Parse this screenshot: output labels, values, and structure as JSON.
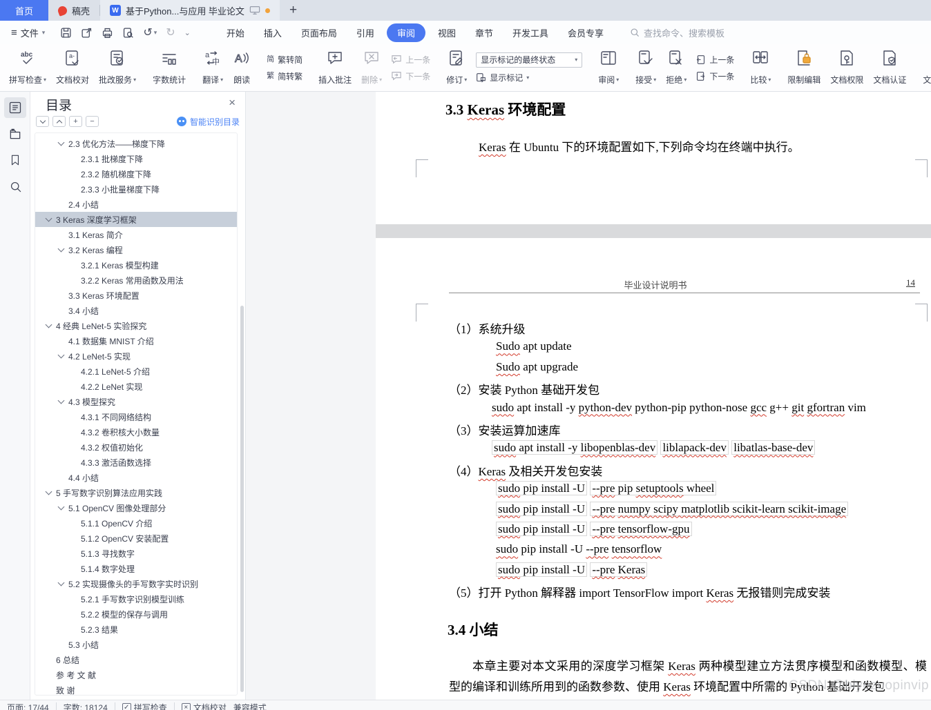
{
  "colors": {
    "accent": "#4b78f1",
    "tab_active_blue": "#4b78f1",
    "gaoke_red": "#e84335",
    "modified_dot": "#f2a33c",
    "squiggle_red": "#d23a2a",
    "toc_selected_bg": "#c7cfda",
    "lock_orange": "#f0a93c"
  },
  "tabs": {
    "home": "首页",
    "gaoke": "稿壳",
    "doc_title": "基于Python...与应用 毕业论文",
    "plus": "+"
  },
  "menu": {
    "file_label": "文件",
    "items": [
      "开始",
      "插入",
      "页面布局",
      "引用",
      "审阅",
      "视图",
      "章节",
      "开发工具",
      "会员专享"
    ],
    "active_item": "审阅",
    "search_placeholder": "查找命令、搜索模板"
  },
  "ribbon": {
    "spellcheck": "拼写检查",
    "proofread": "文档校对",
    "grading": "批改服务",
    "wordcount": "字数统计",
    "translate": "翻译",
    "readaloud": "朗读",
    "fan2jian": "繁转简",
    "jian2fan": "简转繁",
    "insert_comment": "插入批注",
    "delete": "删除",
    "prev_comment": "上一条",
    "next_comment": "下一条",
    "revise": "修订",
    "markstate_combo": "显示标记的最终状态",
    "showmark": "显示标记",
    "reviewpane": "审阅",
    "accept": "接受",
    "reject": "拒绝",
    "prev_rev": "上一条",
    "next_rev": "下一条",
    "compare": "比较",
    "restrict": "限制编辑",
    "perm": "文档权限",
    "cert": "文档认证",
    "final": "文档定稿"
  },
  "toc": {
    "title": "目录",
    "smart_label": "智能识别目录",
    "tools": [
      "collapse-all",
      "expand-all",
      "expand",
      "collapse"
    ],
    "items": [
      {
        "lv": 2,
        "chev": 1,
        "t": "2.3 优化方法——梯度下降"
      },
      {
        "lv": 3,
        "t": "2.3.1 批梯度下降"
      },
      {
        "lv": 3,
        "t": "2.3.2 随机梯度下降"
      },
      {
        "lv": 3,
        "t": "2.3.3 小批量梯度下降"
      },
      {
        "lv": 2,
        "t": "2.4 小结"
      },
      {
        "lv": 1,
        "chev": 1,
        "sel": 1,
        "t": "3 Keras 深度学习框架"
      },
      {
        "lv": 2,
        "t": "3.1 Keras 简介"
      },
      {
        "lv": 2,
        "chev": 1,
        "t": "3.2 Keras 编程"
      },
      {
        "lv": 3,
        "t": "3.2.1 Keras 模型构建"
      },
      {
        "lv": 3,
        "t": "3.2.2 Keras 常用函数及用法"
      },
      {
        "lv": 2,
        "t": "3.3 Keras 环境配置"
      },
      {
        "lv": 2,
        "t": "3.4 小结"
      },
      {
        "lv": 1,
        "chev": 1,
        "t": "4 经典 LeNet-5 实验探究"
      },
      {
        "lv": 2,
        "t": "4.1 数据集 MNIST 介绍"
      },
      {
        "lv": 2,
        "chev": 1,
        "t": "4.2 LeNet-5 实现"
      },
      {
        "lv": 3,
        "t": "4.2.1 LeNet-5 介绍"
      },
      {
        "lv": 3,
        "t": "4.2.2 LeNet 实现"
      },
      {
        "lv": 2,
        "chev": 1,
        "t": "4.3 模型探究"
      },
      {
        "lv": 3,
        "t": "4.3.1 不同网络结构"
      },
      {
        "lv": 3,
        "t": "4.3.2 卷积核大小数量"
      },
      {
        "lv": 3,
        "t": "4.3.2 权值初始化"
      },
      {
        "lv": 3,
        "t": "4.3.3 激活函数选择"
      },
      {
        "lv": 2,
        "t": "4.4 小结"
      },
      {
        "lv": 1,
        "chev": 1,
        "t": "5 手写数字识别算法应用实践"
      },
      {
        "lv": 2,
        "chev": 1,
        "t": "5.1 OpenCV 图像处理部分"
      },
      {
        "lv": 3,
        "t": "5.1.1 OpenCV 介绍"
      },
      {
        "lv": 3,
        "t": "5.1.2 OpenCV 安装配置"
      },
      {
        "lv": 3,
        "t": "5.1.3 寻找数字"
      },
      {
        "lv": 3,
        "t": "5.1.4 数字处理"
      },
      {
        "lv": 2,
        "chev": 1,
        "t": "5.2 实现摄像头的手写数字实时识别"
      },
      {
        "lv": 3,
        "t": "5.2.1 手写数字识别模型训练"
      },
      {
        "lv": 3,
        "t": "5.2.2 模型的保存与调用"
      },
      {
        "lv": 3,
        "t": "5.2.3 结果"
      },
      {
        "lv": 2,
        "t": "5.3 小结"
      },
      {
        "lv": 1,
        "t": "6 总结"
      },
      {
        "lv": 1,
        "t": "参 考 文 献"
      },
      {
        "lv": 1,
        "t": "致 谢"
      }
    ]
  },
  "doc": {
    "page1": {
      "heading": [
        {
          "t": "3.3 "
        },
        {
          "t": "Keras",
          "sq": 1
        },
        {
          "t": " 环境配置"
        }
      ],
      "para": [
        {
          "t": "Keras",
          "sq": 1
        },
        {
          "t": " 在 Ubuntu 下的环境配置如下,下列命令均在终端中执行。"
        }
      ]
    },
    "page2": {
      "header_title": "毕业设计说明书",
      "page_number": "14",
      "lines": [
        {
          "indent": 0,
          "segs": [
            {
              "t": "（1）系统升级"
            }
          ]
        },
        {
          "indent": 2,
          "segs": [
            {
              "t": "Sudo",
              "sq": 1
            },
            {
              "t": " apt update"
            }
          ]
        },
        {
          "indent": 2,
          "segs": [
            {
              "t": "Sudo",
              "sq": 1
            },
            {
              "t": " apt upgrade"
            }
          ]
        },
        {
          "indent": 0,
          "segs": [
            {
              "t": "（2）安装 Python 基础开发包"
            }
          ]
        },
        {
          "indent": 1,
          "segs": [
            {
              "t": "sudo",
              "sq": 1
            },
            {
              "t": " apt install -y "
            },
            {
              "t": "python-dev",
              "sq": 1
            },
            {
              "t": " python-pip python-nose "
            },
            {
              "t": "gcc",
              "sq": 1
            },
            {
              "t": " g++ "
            },
            {
              "t": "git",
              "sq": 1
            },
            {
              "t": " "
            },
            {
              "t": "gfortran",
              "sq": 1
            },
            {
              "t": " vim"
            }
          ]
        },
        {
          "indent": 0,
          "segs": [
            {
              "t": "（3）安装运算加速库"
            }
          ]
        },
        {
          "indent": 1,
          "segs": [
            {
              "box": [
                {
                  "t": "sudo",
                  "sq": 1
                },
                {
                  "t": " apt install -y "
                },
                {
                  "t": "libopenblas-dev",
                  "sq": 1
                }
              ]
            },
            {
              "t": " "
            },
            {
              "box": [
                {
                  "t": "liblapack-dev",
                  "sq": 1
                }
              ]
            },
            {
              "t": " "
            },
            {
              "box": [
                {
                  "t": "libatlas-base-dev",
                  "sq": 1
                }
              ]
            }
          ]
        },
        {
          "indent": 0,
          "segs": [
            {
              "t": "（4）"
            },
            {
              "t": "Keras",
              "sq": 1
            },
            {
              "t": " 及相关开发包安装"
            }
          ]
        },
        {
          "indent": 2,
          "segs": [
            {
              "box": [
                {
                  "t": "sudo",
                  "sq": 1
                },
                {
                  "t": " pip install -U"
                }
              ]
            },
            {
              "t": " "
            },
            {
              "box": [
                {
                  "t": "--pre",
                  "sq": 1
                },
                {
                  "t": " pip "
                },
                {
                  "t": "setuptools",
                  "sq": 1
                },
                {
                  "t": " wheel"
                }
              ]
            }
          ]
        },
        {
          "indent": 2,
          "segs": [
            {
              "box": [
                {
                  "t": "sudo",
                  "sq": 1
                },
                {
                  "t": " pip install -U"
                }
              ]
            },
            {
              "t": " "
            },
            {
              "box": [
                {
                  "t": "--pre",
                  "sq": 1
                },
                {
                  "t": " "
                },
                {
                  "t": "numpy scipy matplotlib scikit-learn scikit-image",
                  "sq": 1
                }
              ]
            }
          ]
        },
        {
          "indent": 2,
          "segs": [
            {
              "box": [
                {
                  "t": "sudo",
                  "sq": 1
                },
                {
                  "t": " pip install -U"
                }
              ]
            },
            {
              "t": " "
            },
            {
              "box": [
                {
                  "t": "--pre",
                  "sq": 1
                },
                {
                  "t": " "
                },
                {
                  "t": "tensorflow-gpu",
                  "sq": 1
                }
              ]
            }
          ]
        },
        {
          "indent": 2,
          "segs": [
            {
              "t": "sudo",
              "sq": 1
            },
            {
              "t": " pip install -U "
            },
            {
              "t": "--pre",
              "sq": 1
            },
            {
              "t": " "
            },
            {
              "t": "tensorflow",
              "sq": 1
            }
          ]
        },
        {
          "indent": 2,
          "segs": [
            {
              "box": [
                {
                  "t": "sudo",
                  "sq": 1
                },
                {
                  "t": " pip install -U"
                }
              ]
            },
            {
              "t": " "
            },
            {
              "box": [
                {
                  "t": "--pre",
                  "sq": 1
                },
                {
                  "t": " "
                },
                {
                  "t": "Keras",
                  "sq": 1
                }
              ]
            }
          ]
        },
        {
          "indent": 0,
          "segs": [
            {
              "t": "（5）打开 Python 解释器  import TensorFlow import "
            },
            {
              "t": "Keras",
              "sq": 1
            },
            {
              "t": "  无报错则完成安装"
            }
          ]
        }
      ],
      "heading2": [
        {
          "t": "3.4 小结"
        }
      ],
      "summary": [
        {
          "t": "本章主要对本文采用的深度学习框架 "
        },
        {
          "t": "Keras",
          "sq": 1
        },
        {
          "t": " 两种模型建立方法贯序模型和函数模型、模型的编译和训练所用到的函数参数、使用 "
        },
        {
          "t": "Keras",
          "sq": 1
        },
        {
          "t": " 环境配置中所需的 Python 基础开发包"
        }
      ]
    }
  },
  "statusbar": {
    "page_label": "页面: 17/44",
    "words_label": "字数: 18124",
    "spellcheck_label": "拼写检查",
    "proofread_label": "文档校对",
    "compat_label": "兼容模式"
  },
  "watermark": "CSDN @biyezuopinvip"
}
